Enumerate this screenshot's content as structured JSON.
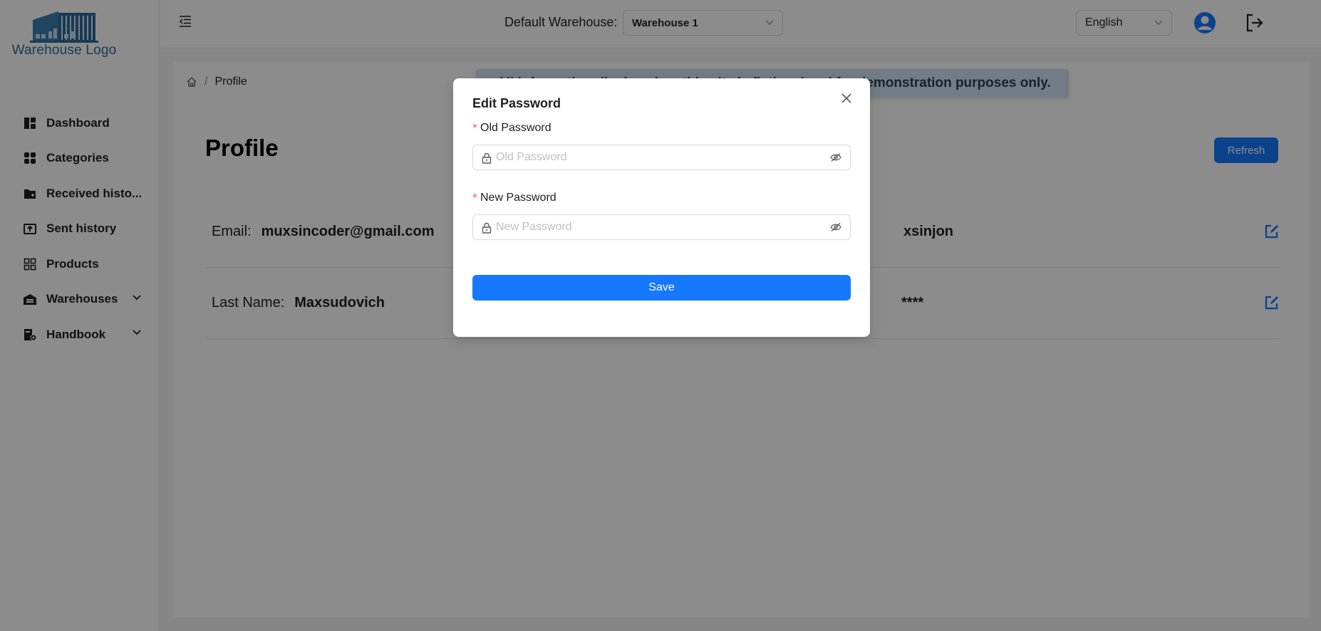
{
  "sidebar": {
    "logo_text": "Warehouse Logo",
    "items": [
      {
        "label": "Dashboard",
        "icon": "dashboard-icon"
      },
      {
        "label": "Categories",
        "icon": "categories-icon"
      },
      {
        "label": "Received histo...",
        "icon": "folder-received-icon"
      },
      {
        "label": "Sent history",
        "icon": "sent-box-icon"
      },
      {
        "label": "Products",
        "icon": "products-grid-icon"
      },
      {
        "label": "Warehouses",
        "icon": "warehouse-icon",
        "expandable": true
      },
      {
        "label": "Handbook",
        "icon": "handbook-icon",
        "expandable": true
      }
    ]
  },
  "header": {
    "warehouse_label": "Default Warehouse:",
    "warehouse_value": "Warehouse 1",
    "language_value": "English"
  },
  "content": {
    "breadcrumb_current": "Profile",
    "breadcrumb_sep": "/",
    "banner_text": "All information displayed on this site is fictional and for demonstration purposes only.",
    "page_title": "Profile",
    "refresh_label": "Refresh",
    "fields": {
      "email_key": "Email:",
      "email_value": "muxsincoder@gmail.com",
      "first_name_value": "xsinjon",
      "last_name_key": "Last Name:",
      "last_name_value": "Maxsudovich",
      "password_value": "****"
    }
  },
  "modal": {
    "title": "Edit Password",
    "old_label": "Old Password",
    "old_placeholder": "Old Password",
    "new_label": "New Password",
    "new_placeholder": "New Password",
    "required_mark": "*",
    "save_label": "Save"
  },
  "colors": {
    "primary": "#1677ff",
    "logo": "#2d6a9a",
    "banner_bg": "#cfe0f5",
    "required": "#ff4d4f"
  }
}
